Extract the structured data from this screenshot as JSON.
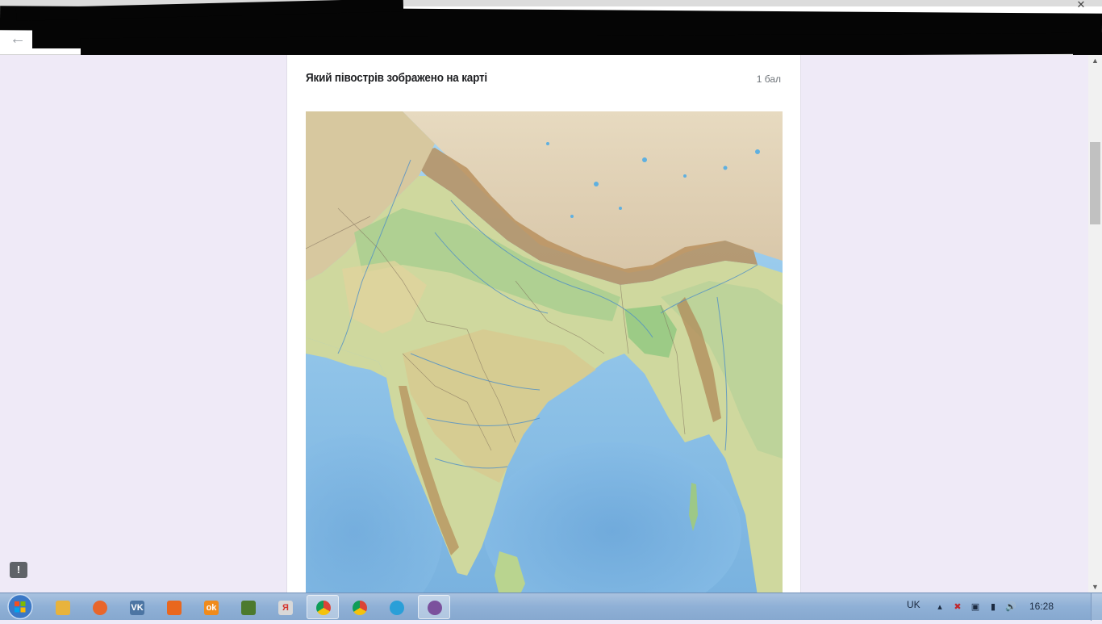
{
  "question": {
    "title": "Який півострів зображено на карті",
    "points": "1 бал"
  },
  "map": {
    "alt": "map-of-south-asia"
  },
  "taskbar": {
    "apps": [
      {
        "name": "explorer",
        "letter": "",
        "color": "#e8b33c"
      },
      {
        "name": "firefox",
        "letter": "",
        "color": "#e8662b"
      },
      {
        "name": "vk",
        "letter": "VK",
        "color": "#4c75a3"
      },
      {
        "name": "store",
        "letter": "",
        "color": "#e9671e"
      },
      {
        "name": "odnoklassniki",
        "letter": "ok",
        "color": "#f08b1c"
      },
      {
        "name": "minecraft",
        "letter": "",
        "color": "#4c7a2e"
      },
      {
        "name": "yandex",
        "letter": "Я",
        "color": "#d8d8d8"
      },
      {
        "name": "chrome-active",
        "letter": "",
        "color": "#2f9b4a"
      },
      {
        "name": "chrome",
        "letter": "",
        "color": "#2f9b4a"
      },
      {
        "name": "telegram",
        "letter": "",
        "color": "#2a9fd8"
      },
      {
        "name": "viber",
        "letter": "",
        "color": "#7b519d"
      }
    ],
    "language": "UK",
    "time": "16:28"
  },
  "colors": {
    "page_bg": "#efeaf7",
    "card_bg": "#ffffff",
    "sea": "#8cc4ea",
    "land": "#d4dca5"
  }
}
